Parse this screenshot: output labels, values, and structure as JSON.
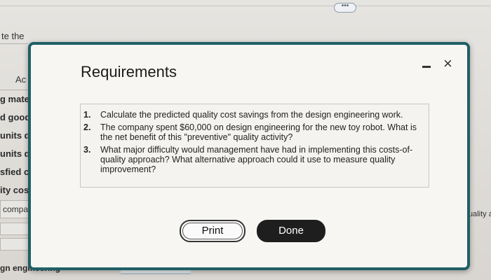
{
  "background": {
    "texts": [
      "te the",
      "Ac",
      "g mate",
      "d goods",
      "units di",
      "units di",
      "sfied cu",
      "ity cost",
      "company",
      "gn engineering",
      "uality activ"
    ]
  },
  "toolbar": {
    "ellipsis": "•••"
  },
  "modal": {
    "title": "Requirements",
    "requirements": [
      {
        "num": "1.",
        "text": "Calculate the predicted quality cost savings from the design engineering work."
      },
      {
        "num": "2.",
        "text": "The company spent $60,000 on design engineering for the new toy robot. What is the net benefit of this \"preventive\" quality activity?"
      },
      {
        "num": "3.",
        "text": "What major difficulty would management have had in implementing this costs-of-quality approach? What alternative approach could it use to measure quality improvement?"
      }
    ],
    "print_label": "Print",
    "done_label": "Done",
    "close_symbol": "×"
  }
}
